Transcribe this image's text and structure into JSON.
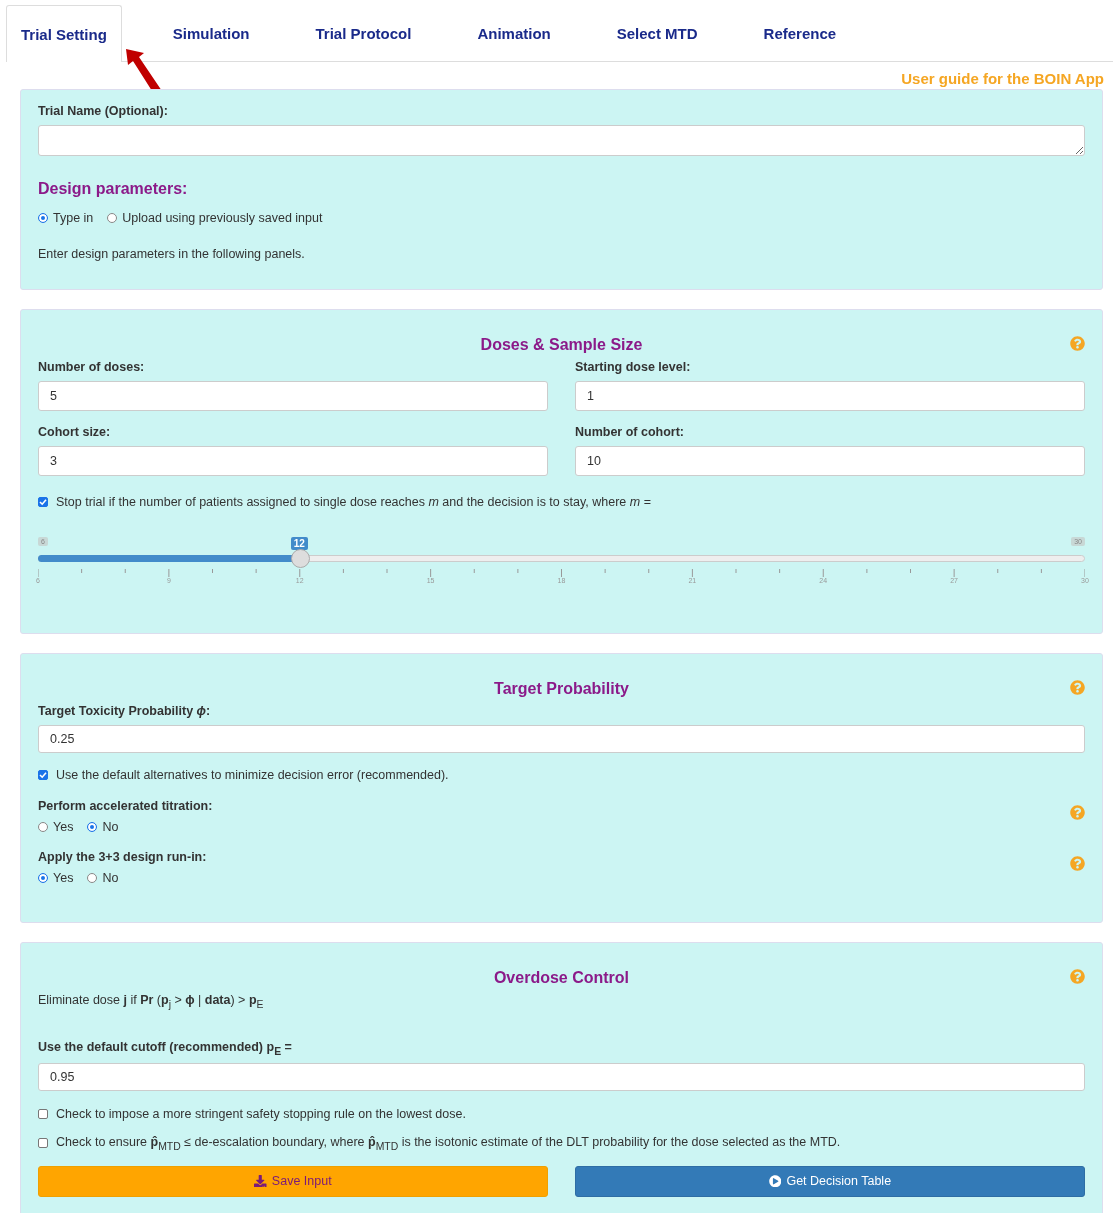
{
  "tabs": [
    {
      "label": "Trial Setting",
      "selected": true
    },
    {
      "label": "Simulation",
      "selected": false
    },
    {
      "label": "Trial Protocol",
      "selected": false
    },
    {
      "label": "Animation",
      "selected": false
    },
    {
      "label": "Select MTD",
      "selected": false
    },
    {
      "label": "Reference",
      "selected": false
    }
  ],
  "user_guide_link": "User guide for the BOIN App",
  "trial_panel": {
    "name_label": "Trial Name (Optional):",
    "section_title": "Design parameters:",
    "input_modes": [
      {
        "label": "Type in",
        "selected": true
      },
      {
        "label": "Upload using previously saved input",
        "selected": false
      }
    ],
    "note": "Enter design parameters in the following panels."
  },
  "doses_panel": {
    "title": "Doses & Sample Size",
    "fields": [
      {
        "label": "Number of doses:",
        "value": "5"
      },
      {
        "label": "Starting dose level:",
        "value": "1"
      },
      {
        "label": "Cohort size:",
        "value": "3"
      },
      {
        "label": "Number of cohort:",
        "value": "10"
      }
    ],
    "stop_rule": {
      "text": "Stop trial if the number of patients assigned to single dose reaches *m* and the decision is to stay, where *m* =",
      "checked": true
    },
    "slider": {
      "min_label": "6",
      "max_label": "30",
      "value_label": "12",
      "level": 0.25,
      "ticks": [
        "6",
        "9",
        "12",
        "15",
        "18",
        "21",
        "24",
        "27",
        "30"
      ]
    }
  },
  "target_panel": {
    "title": "Target Probability",
    "toxicity_label": "Target Toxicity Probability *ϕ*:",
    "toxicity_value": "0.25",
    "default_alternatives": {
      "text": "Use the default alternatives to minimize decision error (recommended).",
      "checked": true
    },
    "questions": [
      {
        "label": "Perform accelerated titration:",
        "options": [
          {
            "label": "Yes",
            "selected": false
          },
          {
            "label": "No",
            "selected": true
          }
        ]
      },
      {
        "label": "Apply the 3+3 design run-in:",
        "options": [
          {
            "label": "Yes",
            "selected": true
          },
          {
            "label": "No",
            "selected": false
          }
        ]
      }
    ]
  },
  "overdose_panel": {
    "title": "Overdose Control",
    "rule": "Eliminate dose **j** if **Pr** (**p**$_{j}$ > **ϕ** | **data**) > **p**$_{E}$",
    "cutoff_label": "Use the default cutoff (recommended) **p**$_{E}$ =",
    "cutoff_value": "0.95",
    "checks": [
      {
        "text": "Check to impose a more stringent safety stopping rule on the lowest dose.",
        "checked": false
      },
      {
        "text": "Check to ensure **p̂**$_{MTD}$ ≤ de-escalation boundary, where **p̂**$_{MTD}$ is the isotonic estimate of the DLT probability for the dose selected as the MTD.",
        "checked": false
      }
    ],
    "buttons": [
      {
        "kind": "download",
        "label": "Save Input"
      },
      {
        "kind": "play",
        "label": "Get Decision Table"
      }
    ]
  }
}
